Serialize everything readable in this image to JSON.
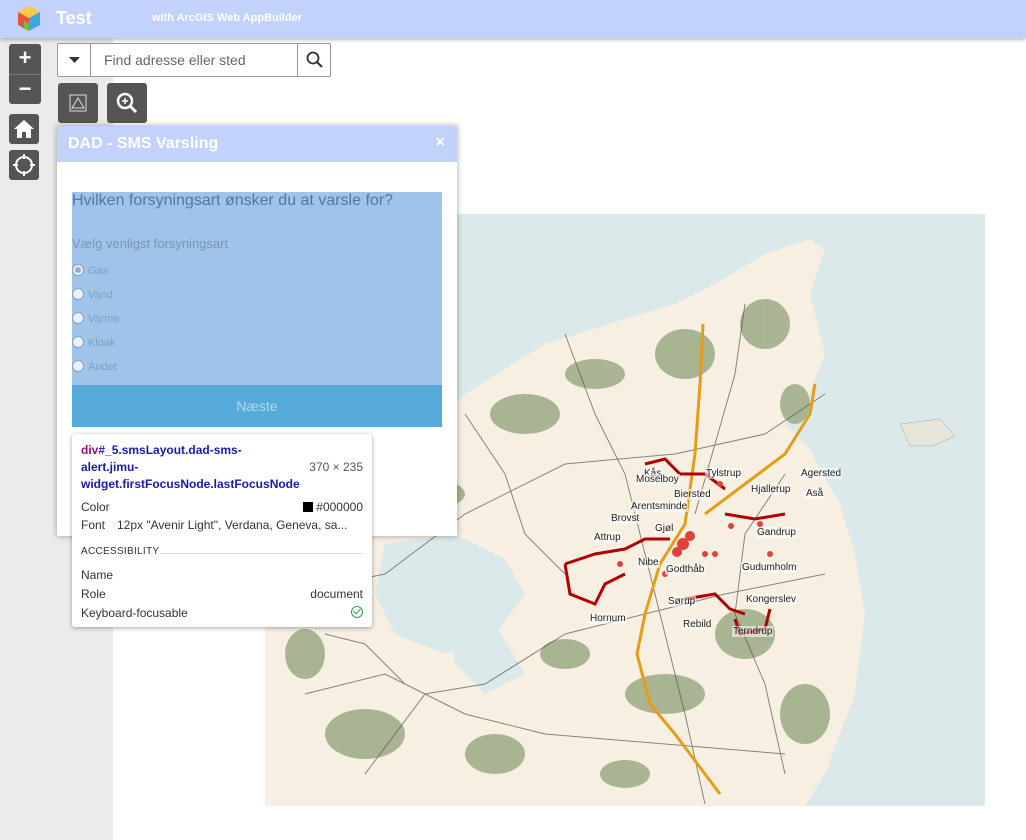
{
  "app": {
    "title": "Test",
    "subtitle": "with ArcGIS Web AppBuilder",
    "header_color": "#c2d2fb"
  },
  "map_controls": {
    "zoom_in": "+",
    "zoom_out": "−",
    "home_icon": "home-icon",
    "locate_icon": "locate-icon"
  },
  "search": {
    "placeholder": "Find adresse eller sted",
    "dropdown_icon": "caret-down-icon",
    "search_icon": "search-icon"
  },
  "widgets": {
    "warning_icon": "warning-triangle-icon",
    "zoom_icon": "magnifier-zoom-icon"
  },
  "panel": {
    "title": "DAD - SMS Varsling",
    "close": "×",
    "question": "Hvilken forsyningsart ønsker du at varsle for?",
    "subtitle": "Vælg venligst forsyningsart",
    "options": [
      {
        "label": "Gas",
        "checked": true
      },
      {
        "label": "Vand",
        "checked": false
      },
      {
        "label": "Varme",
        "checked": false
      },
      {
        "label": "Kloak",
        "checked": false
      },
      {
        "label": "Andet",
        "checked": false
      }
    ],
    "next_label": "Næste",
    "highlight_color": "#a0c4e9",
    "button_color": "#56abdb"
  },
  "inspector": {
    "tag": "div",
    "selector_rest": "#_5.smsLayout.dad-sms-alert.jimu-widget.firstFocusNode.lastFocusNode",
    "size": "370 × 235",
    "color_label": "Color",
    "color_value": "#000000",
    "font_label": "Font",
    "font_value": "12px \"Avenir Light\", Verdana, Geneva, sa...",
    "accessibility_label": "ACCESSIBILITY",
    "name_label": "Name",
    "name_value": "",
    "role_label": "Role",
    "role_value": "document",
    "keyboard_label": "Keyboard-focusable",
    "keyboard_icon": "check-circle-icon"
  },
  "map_labels": {
    "kaas": "Kås",
    "moselboy": "Moselboy",
    "tylstrup": "Tylstrup",
    "agersted": "Agersted",
    "bierstedt": "Biersted",
    "hjallerup": "Hjallerup",
    "asaa": "Aså",
    "arentsminde": "Arentsminde",
    "brovst": "Brovst",
    "gjol": "Gjøl",
    "attrup": "Attrup",
    "gandrup": "Gandrup",
    "nibe": "Nibe",
    "godthaab": "Godthåb",
    "gudumholm": "Gudumholm",
    "sorup": "Sørup",
    "kongerslev": "Kongerslev",
    "hornum": "Hornum",
    "rebild": "Rebild",
    "terndrup": "Terndrup"
  }
}
